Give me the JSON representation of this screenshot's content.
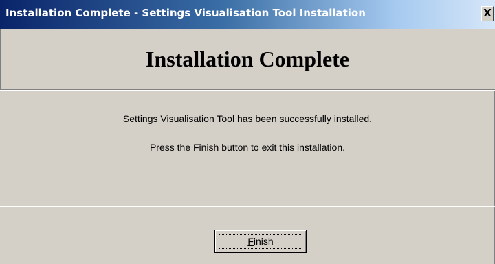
{
  "window": {
    "title": "Installation Complete - Settings Visualisation Tool Installation",
    "close_label": "X"
  },
  "header": {
    "title": "Installation Complete"
  },
  "body": {
    "message_line1": "Settings Visualisation Tool has been successfully installed.",
    "message_line2": "Press the Finish button to exit this installation."
  },
  "buttons": {
    "finish": {
      "mnemonic": "F",
      "rest": "inish"
    }
  },
  "colors": {
    "titlebar_start": "#0a246a",
    "titlebar_end": "#d6e6f8",
    "face": "#d4d0c8"
  }
}
